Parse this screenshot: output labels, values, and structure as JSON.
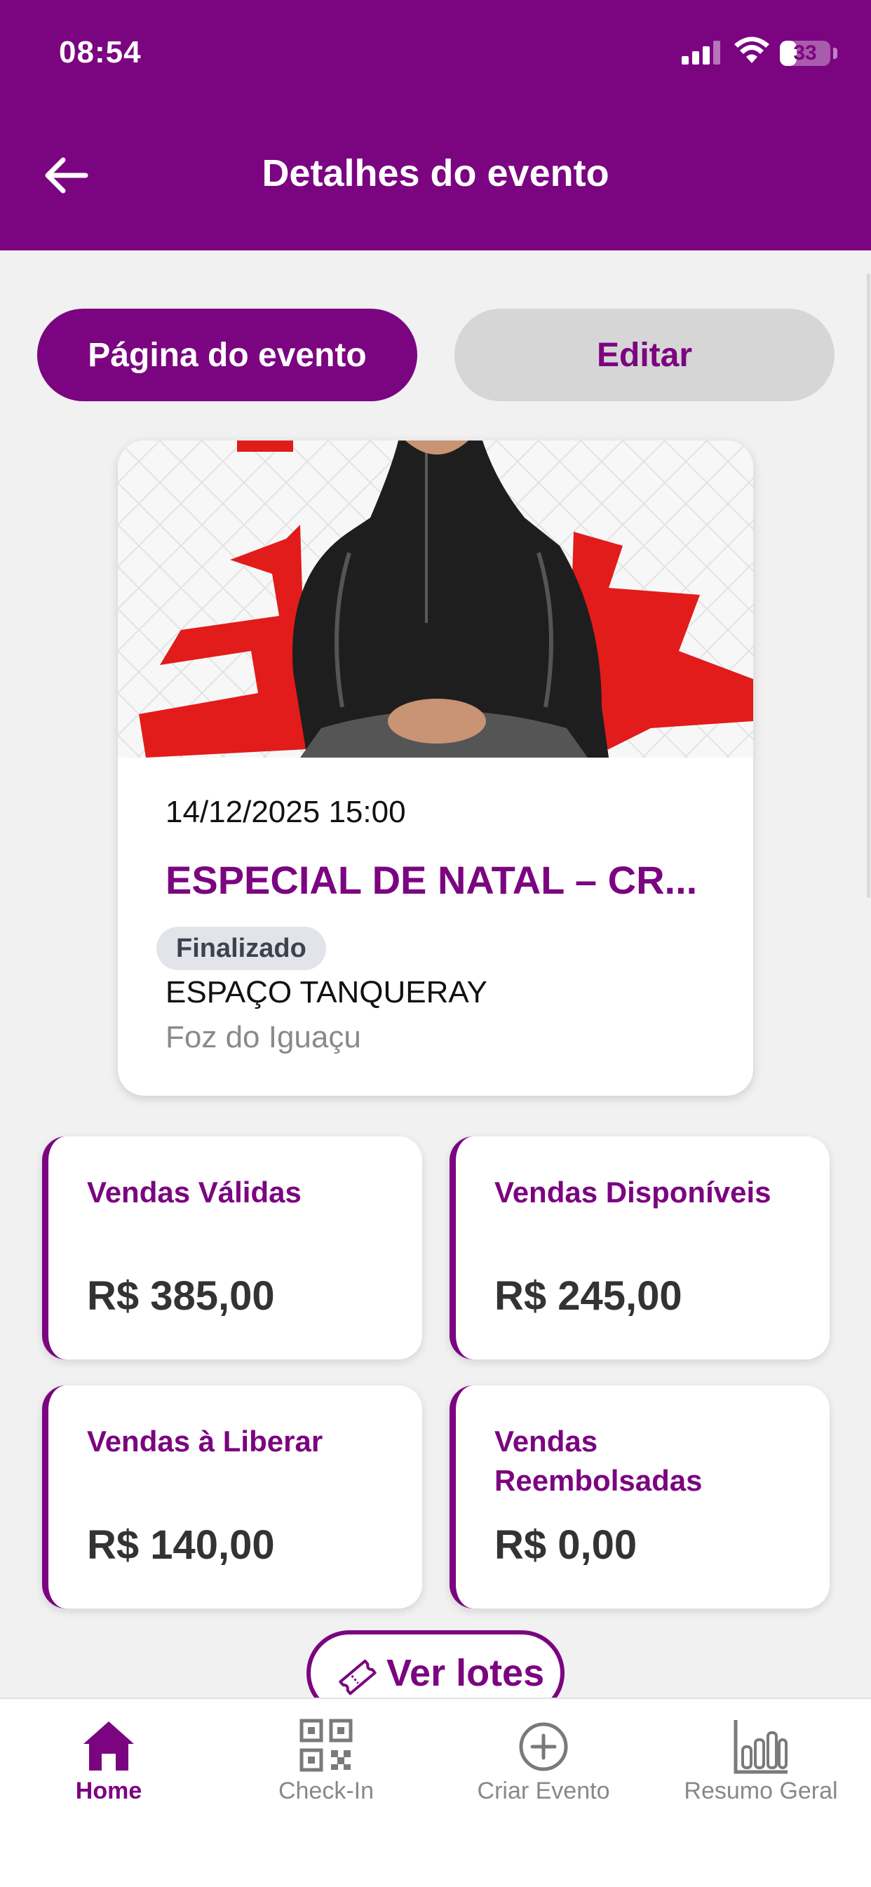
{
  "status_bar": {
    "time": "08:54",
    "battery": "33",
    "battery_level": 0.33,
    "icons": [
      "cellular-signal-icon",
      "wifi-icon",
      "battery-icon"
    ]
  },
  "header": {
    "title": "Detalhes do evento",
    "back_icon": "arrow-left-icon"
  },
  "actions": {
    "event_page_label": "Página do evento",
    "edit_label": "Editar"
  },
  "event": {
    "image": "event-banner-image",
    "date": "14/12/2025 15:00",
    "title": "ESPECIAL DE NATAL – CR...",
    "status": "Finalizado",
    "venue": "ESPAÇO TANQUERAY",
    "city": "Foz do Iguaçu"
  },
  "stats": [
    {
      "label": "Vendas Válidas",
      "value": "R$ 385,00"
    },
    {
      "label": "Vendas Disponíveis",
      "value": "R$ 245,00"
    },
    {
      "label": "Vendas à Liberar",
      "value": "R$ 140,00"
    },
    {
      "label": "Vendas Reembolsadas",
      "value": "R$ 0,00"
    }
  ],
  "lotes_button": {
    "label": "Ver lotes",
    "icon": "ticket-icon"
  },
  "tabbar": {
    "items": [
      {
        "label": "Home",
        "icon": "home-icon",
        "active": true
      },
      {
        "label": "Check-In",
        "icon": "qr-code-icon",
        "active": false
      },
      {
        "label": "Criar Evento",
        "icon": "plus-circle-icon",
        "active": false
      },
      {
        "label": "Resumo Geral",
        "icon": "bar-chart-icon",
        "active": false
      }
    ]
  },
  "colors": {
    "primary": "#7b0480",
    "background": "#f1f1f1",
    "secondary_button": "#d6d6d6",
    "badge_bg": "#e2e4ea"
  }
}
